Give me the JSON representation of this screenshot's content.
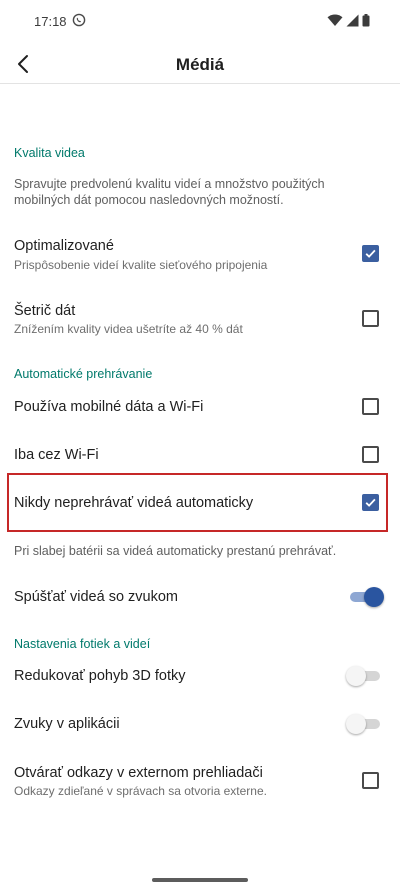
{
  "status_bar": {
    "time": "17:18"
  },
  "header": {
    "title": "Médiá"
  },
  "video_quality": {
    "section_title": "Kvalita videa",
    "description": "Spravujte predvolenú kvalitu videí a množstvo použitých mobilných dát pomocou nasledovných možností.",
    "optimized": {
      "title": "Optimalizované",
      "subtitle": "Prispôsobenie videí kvalite sieťového pripojenia",
      "checked": true
    },
    "data_saver": {
      "title": "Šetrič dát",
      "subtitle": "Znížením kvality videa ušetríte až 40 % dát",
      "checked": false
    }
  },
  "autoplay": {
    "section_title": "Automatické prehrávanie",
    "mobile_wifi": {
      "title": "Používa mobilné dáta a Wi-Fi",
      "checked": false
    },
    "wifi_only": {
      "title": "Iba cez Wi-Fi",
      "checked": false
    },
    "never": {
      "title": "Nikdy neprehrávať videá automaticky",
      "checked": true
    },
    "battery_note": "Pri slabej batérii sa videá automaticky prestanú prehrávať.",
    "with_sound": {
      "title": "Spúšťať videá so zvukom",
      "on": true
    }
  },
  "photos_videos": {
    "section_title": "Nastavenia fotiek a videí",
    "reduce_3d": {
      "title": "Redukovať pohyb 3D fotky",
      "on": false
    },
    "app_sounds": {
      "title": "Zvuky v aplikácii",
      "on": false
    },
    "external_links": {
      "title": "Otvárať odkazy v externom prehliadači",
      "subtitle": "Odkazy zdieľané v správach sa otvoria externe.",
      "checked": false
    }
  },
  "colors": {
    "accent": "#00796b",
    "checkbox": "#3b5fa0",
    "toggle_on": "#2a55a0",
    "highlight": "#c62828"
  },
  "icons": [
    "viber-icon",
    "wifi-icon",
    "signal-icon",
    "battery-icon",
    "back-arrow-icon",
    "check-icon"
  ]
}
